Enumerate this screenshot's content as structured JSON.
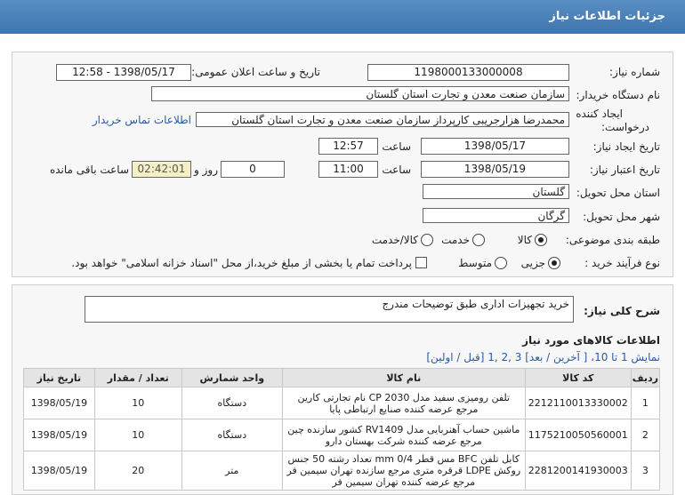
{
  "header": {
    "title": "جزئیات اطلاعات نیاز"
  },
  "form": {
    "need_number_label": "شماره نیاز:",
    "need_number": "1198000133000008",
    "announce_label": "تاریخ و ساعت اعلان عمومی:",
    "announce_value": "1398/05/17 - 12:58",
    "buyer_org_label": "نام دستگاه خریدار:",
    "buyer_org": "سازمان صنعت معدن و تجارت استان گلستان",
    "creator_label_1": "ایجاد کننده",
    "creator_label_2": "درخواست:",
    "creator": "محمدرضا هزارجریبی کارپرداز سازمان صنعت معدن و تجارت استان گلستان",
    "contact_link": "اطلاعات تماس خریدار",
    "create_date_label": "تاریخ ایجاد نیاز:",
    "create_date": "1398/05/17",
    "time_label": "ساعت",
    "create_time": "12:57",
    "valid_date_label": "تاریخ اعتبار نیاز:",
    "valid_date": "1398/05/19",
    "valid_time": "11:00",
    "days_label": "روز و",
    "days": "0",
    "remaining": "02:42:01",
    "remaining_label": "ساعت باقی مانده",
    "province_label": "استان محل تحویل:",
    "province": "گلستان",
    "city_label": "شهر محل تحویل:",
    "city": "گرگان",
    "category_label": "طبقه بندی موضوعی:",
    "category_options": [
      "کالا",
      "خدمت",
      "کالا/خدمت"
    ],
    "process_label": "نوع فرآیند خرید :",
    "process_options": [
      "جزیی",
      "متوسط"
    ],
    "payment_note": "پرداخت تمام یا بخشی از مبلغ خرید،از محل \"اسناد خزانه اسلامی\" خواهد بود."
  },
  "summary": {
    "label": "شرح کلی نیاز:",
    "value": "خرید تجهیزات اداری طبق توضیحات مندرج"
  },
  "goods": {
    "title": "اطلاعات کالاهای مورد نیاز",
    "pager": "نمایش 1 تا 10، [ آخرین / بعد] 3 ,2 ,1 [قبل / اولین]",
    "columns": [
      "ردیف",
      "کد کالا",
      "نام کالا",
      "واحد شمارش",
      "تعداد / مقدار",
      "تاریخ نیاز"
    ],
    "rows": [
      {
        "n": "1",
        "code": "2212110013330002",
        "name": "تلفن رومیزی سفید مدل CP 2030 نام تجارتی کارین مرجع عرضه کننده صنایع ارتباطی پایا",
        "unit": "دستگاه",
        "qty": "10",
        "date": "1398/05/19"
      },
      {
        "n": "2",
        "code": "1175210050560001",
        "name": "ماشین حساب آهنربایی مدل RV1409 کشور سازنده چین مرجع عرضه کننده شرکت بهستان دارو",
        "unit": "دستگاه",
        "qty": "10",
        "date": "1398/05/19"
      },
      {
        "n": "3",
        "code": "2281200141930003",
        "name": "کابل تلفن BFC مس قطر mm 0/4 تعداد رشته 50 جنس روکش LDPE قرقره متری مرجع سازنده تهران سیمین فر مرجع عرضه کننده تهران سیمین فر",
        "unit": "متر",
        "qty": "20",
        "date": "1398/05/19"
      }
    ]
  }
}
